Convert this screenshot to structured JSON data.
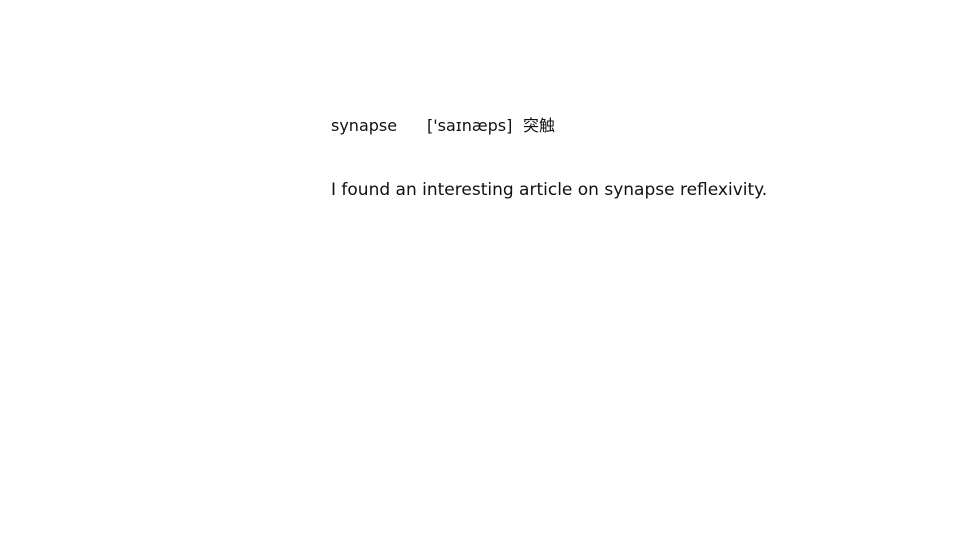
{
  "entry": {
    "word": "synapse",
    "phonetic": "['saɪnæps]",
    "translation": "突触",
    "example": "I found an interesting article on synapse reflexivity."
  }
}
